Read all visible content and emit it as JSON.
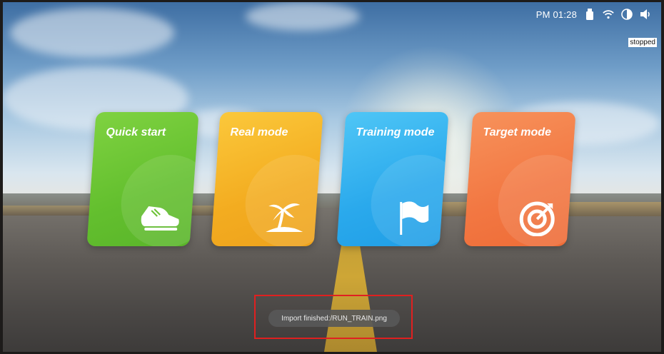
{
  "status_bar": {
    "time": "PM 01:28",
    "icons": [
      "usb-icon",
      "wifi-icon",
      "brightness-icon",
      "volume-icon"
    ]
  },
  "state_label": "stopped",
  "modes": [
    {
      "label": "Quick start",
      "icon": "shoe-icon",
      "color": "#66c22f"
    },
    {
      "label": "Real mode",
      "icon": "palm-island-icon",
      "color": "#f4ae22"
    },
    {
      "label": "Training mode",
      "icon": "flag-icon",
      "color": "#2aa9ec"
    },
    {
      "label": "Target mode",
      "icon": "target-icon",
      "color": "#f27742"
    }
  ],
  "toast": {
    "message": "Import finished:/RUN_TRAIN.png",
    "highlight_color": "#e02020"
  }
}
